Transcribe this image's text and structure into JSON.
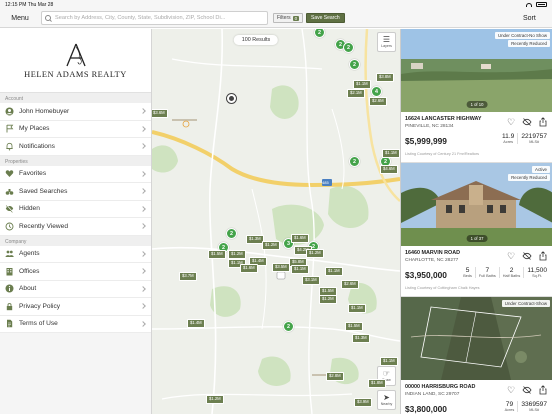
{
  "status_bar": {
    "time": "12:15 PM",
    "date": "Thu Mar 28",
    "battery": ""
  },
  "nav": {
    "menu_label": "Menu",
    "search_placeholder": "Search by Address, City, County, State, Subdivision, ZIP, School Di...",
    "filters_label": "Filters",
    "filters_count": "0",
    "save_search_label": "Save Search",
    "sort_label": "Sort"
  },
  "sidebar": {
    "brand": "HELEN ADAMS REALTY",
    "account_label": "Account",
    "account_items": [
      {
        "label": "John Homebuyer",
        "icon": "user-circle-icon"
      },
      {
        "label": "My Places",
        "icon": "flag-icon"
      },
      {
        "label": "Notifications",
        "icon": "bell-icon"
      }
    ],
    "properties_label": "Properties",
    "property_items": [
      {
        "label": "Favorites",
        "icon": "heart-icon"
      },
      {
        "label": "Saved Searches",
        "icon": "binoculars-icon"
      },
      {
        "label": "Hidden",
        "icon": "eye-slash-icon"
      },
      {
        "label": "Recently Viewed",
        "icon": "history-icon"
      }
    ],
    "company_label": "Company",
    "company_items": [
      {
        "label": "Agents",
        "icon": "agents-icon"
      },
      {
        "label": "Offices",
        "icon": "building-icon"
      },
      {
        "label": "About",
        "icon": "info-icon"
      },
      {
        "label": "Privacy Policy",
        "icon": "lock-icon"
      },
      {
        "label": "Terms of Use",
        "icon": "document-icon"
      }
    ]
  },
  "map": {
    "results": "100 Results",
    "layers_label": "Layers",
    "draw_label": "Draw",
    "nearby_label": "Nearby",
    "road_label": "485",
    "clusters": [
      "2",
      "2",
      "2",
      "2",
      "4",
      "2",
      "2",
      "2",
      "3",
      "2",
      "2",
      "2"
    ],
    "pins": [
      "$1.1M",
      "$2.1M",
      "$2.6M",
      "$3.6M",
      "$4.6M",
      "$1.3M",
      "$1.6M",
      "$1.5M",
      "$1.2M",
      "$1.1M",
      "$1.4M",
      "$4.2M",
      "$1.2M",
      "$5.8M",
      "$1.1M",
      "$3.7M",
      "$2.6M",
      "$1.5M",
      "$1.2M",
      "$1.1M",
      "$1.4M",
      "$1.5M",
      "$1.1M",
      "$2.8M",
      "$3.9M",
      "$1.2M",
      "$3.8M",
      "$3.5M",
      "$1.8M",
      "$1.1M",
      "$1.3M",
      "$3.1M",
      "$1.6M",
      "$1.2M",
      "$1.1M"
    ]
  },
  "listings": [
    {
      "badges": [
        "Under Contract-No Show",
        "Recently Reduced"
      ],
      "photo_counter": "1 of 10",
      "address": "16624 LANCASTER HIGHWAY",
      "city": "PINEVILLE, NC 28134",
      "price": "$5,999,999",
      "stats": [
        {
          "value": "11.9",
          "label": "Acres"
        },
        {
          "value": "2219757",
          "label": "MLS#"
        }
      ],
      "courtesy": "Listing Courtesy of Century 21 Fmr/Realtors"
    },
    {
      "badges": [
        "Active",
        "Recently Reduced"
      ],
      "photo_counter": "1 of 37",
      "address": "16460 MARVIN ROAD",
      "city": "CHARLOTTE, NC 28277",
      "price": "$3,950,000",
      "stats": [
        {
          "value": "5",
          "label": "Beds"
        },
        {
          "value": "7",
          "label": "Full Baths"
        },
        {
          "value": "2",
          "label": "Half Baths"
        },
        {
          "value": "11,500",
          "label": "Sq.Ft."
        }
      ],
      "courtesy": "Listing Courtesy of Cottingham Chalk Hayes"
    },
    {
      "badges": [
        "Under Contract-Show"
      ],
      "photo_counter": "",
      "address": "00000 HARRISBURG ROAD",
      "city": "INDIAN LAND, SC 29707",
      "price": "$3,800,000",
      "stats": [
        {
          "value": "79",
          "label": "Acres"
        },
        {
          "value": "3369597",
          "label": "MLS#"
        }
      ],
      "courtesy": ""
    }
  ],
  "colors": {
    "accent": "#5f7043",
    "cluster": "#44a34a",
    "pin": "#6c7f50"
  }
}
